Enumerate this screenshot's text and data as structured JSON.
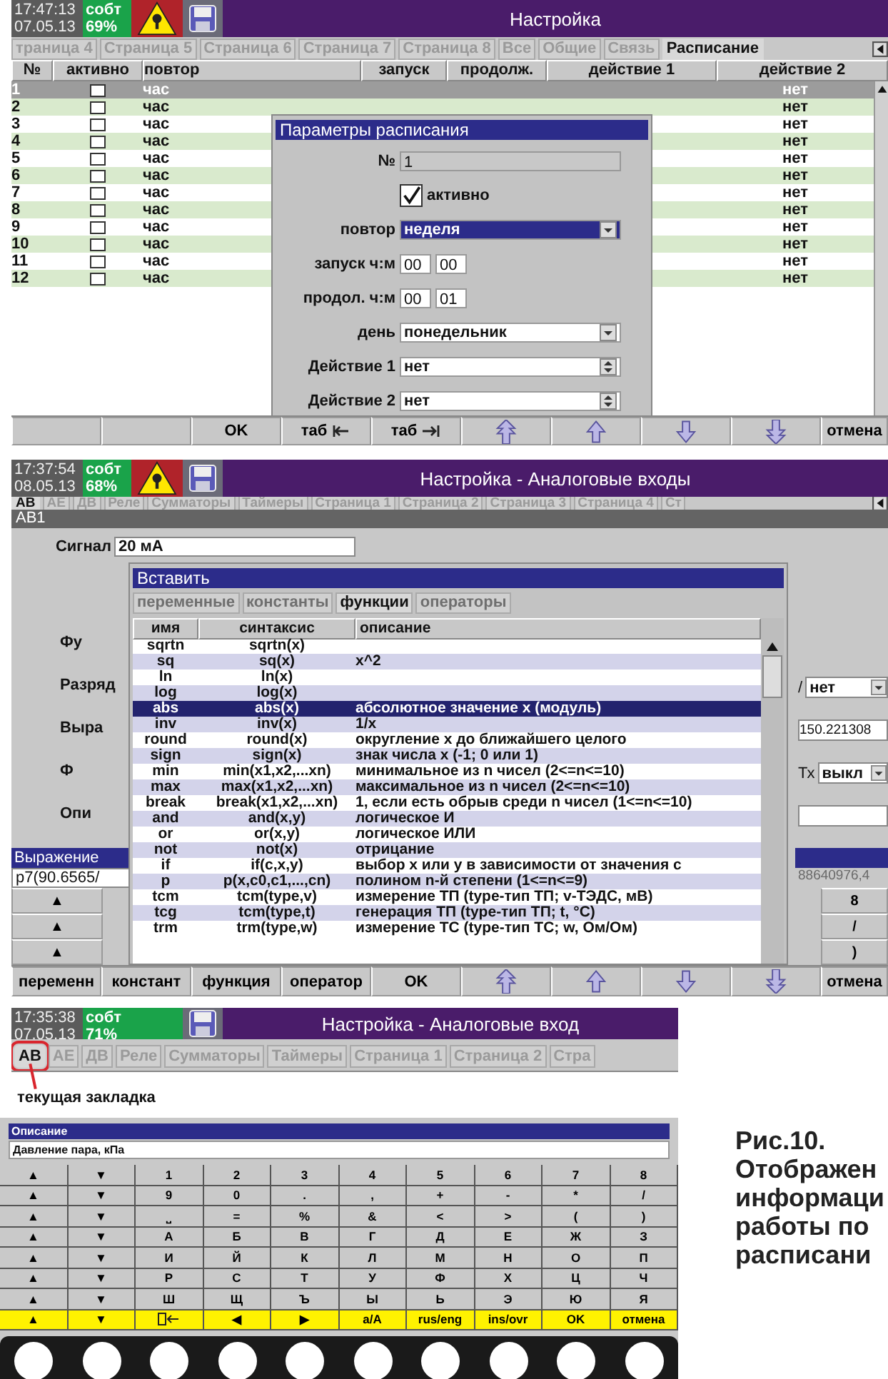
{
  "schedule_screen": {
    "status": {
      "time": "17:47:13",
      "date": "07.05.13",
      "mode": "собт",
      "percent": "69%",
      "warning": true
    },
    "title": "Настройка",
    "tabs": [
      {
        "label": "траница 4",
        "selected": false
      },
      {
        "label": "Страница 5",
        "selected": false
      },
      {
        "label": "Страница 6",
        "selected": false
      },
      {
        "label": "Страница 7",
        "selected": false
      },
      {
        "label": "Страница 8",
        "selected": false
      },
      {
        "label": "Все",
        "selected": false
      },
      {
        "label": "Общие",
        "selected": false
      },
      {
        "label": "Связь",
        "selected": false
      },
      {
        "label": "Расписание",
        "selected": true
      }
    ],
    "columns": [
      "№",
      "активно",
      "повтор",
      "запуск",
      "продолж.",
      "действие 1",
      "действие 2"
    ],
    "rows": [
      {
        "num": "1",
        "active": false,
        "repeat": "час",
        "action_2": "нет",
        "selected": true
      },
      {
        "num": "2",
        "active": false,
        "repeat": "час",
        "action_2": "нет",
        "selected": false
      },
      {
        "num": "3",
        "active": false,
        "repeat": "час",
        "action_2": "нет",
        "selected": false
      },
      {
        "num": "4",
        "active": false,
        "repeat": "час",
        "action_2": "нет",
        "selected": false
      },
      {
        "num": "5",
        "active": false,
        "repeat": "час",
        "action_2": "нет",
        "selected": false
      },
      {
        "num": "6",
        "active": false,
        "repeat": "час",
        "action_2": "нет",
        "selected": false
      },
      {
        "num": "7",
        "active": false,
        "repeat": "час",
        "action_2": "нет",
        "selected": false
      },
      {
        "num": "8",
        "active": false,
        "repeat": "час",
        "action_2": "нет",
        "selected": false
      },
      {
        "num": "9",
        "active": false,
        "repeat": "час",
        "action_2": "нет",
        "selected": false
      },
      {
        "num": "10",
        "active": false,
        "repeat": "час",
        "action_2": "нет",
        "selected": false
      },
      {
        "num": "11",
        "active": false,
        "repeat": "час",
        "action_2": "нет",
        "selected": false
      },
      {
        "num": "12",
        "active": false,
        "repeat": "час",
        "action_2": "нет",
        "selected": false
      }
    ],
    "dialog": {
      "title": "Параметры расписания",
      "number_label": "№",
      "number": "1",
      "active_label": "активно",
      "active": true,
      "fields": [
        {
          "kind": "select",
          "label": "повтор",
          "value": "неделя",
          "highlighted": true
        },
        {
          "kind": "time",
          "label": "запуск ч:м",
          "hours": "00",
          "minutes": "00"
        },
        {
          "kind": "time",
          "label": "продол. ч:м",
          "hours": "00",
          "minutes": "01"
        },
        {
          "kind": "select",
          "label": "день",
          "value": "понедельник",
          "highlighted": false
        },
        {
          "kind": "spin",
          "label": "Действие 1",
          "value": "нет"
        },
        {
          "kind": "spin",
          "label": "Действие 2",
          "value": "нет"
        }
      ]
    },
    "buttons": [
      {
        "kind": "blank"
      },
      {
        "kind": "blank"
      },
      {
        "kind": "text",
        "label": "OK"
      },
      {
        "kind": "tableft",
        "label": "таб"
      },
      {
        "kind": "tabright",
        "label": "таб"
      },
      {
        "kind": "pageup"
      },
      {
        "kind": "up"
      },
      {
        "kind": "down"
      },
      {
        "kind": "pagedown"
      },
      {
        "kind": "text",
        "label": "отмена"
      }
    ]
  },
  "formula_screen": {
    "status": {
      "time": "17:37:54",
      "date": "08.05.13",
      "mode": "собт",
      "percent": "68%",
      "warning": true
    },
    "title": "Настройка - Аналоговые входы",
    "tabs": [
      {
        "label": "АВ",
        "selected": true
      },
      {
        "label": "АЕ",
        "selected": false
      },
      {
        "label": "ДВ",
        "selected": false
      },
      {
        "label": "Реле",
        "selected": false
      },
      {
        "label": "Сумматоры",
        "selected": false
      },
      {
        "label": "Таймеры",
        "selected": false
      },
      {
        "label": "Страница 1",
        "selected": false
      },
      {
        "label": "Страница 2",
        "selected": false
      },
      {
        "label": "Страница 3",
        "selected": false
      },
      {
        "label": "Страница 4",
        "selected": false
      },
      {
        "label": "Ст",
        "selected": false
      }
    ],
    "subtitle": "АВ1",
    "signal_label": "Сигнал",
    "signal_value": "20 мА",
    "form_rows": [
      {
        "label": "Фу",
        "kind": "plain"
      },
      {
        "label": "Разряд",
        "kind": "select",
        "prefix": "/",
        "value": "нет"
      },
      {
        "label": "Выра",
        "kind": "field",
        "value": "150.221308"
      },
      {
        "label": "Ф",
        "kind": "select",
        "prefix": "Тх",
        "value": "выкл"
      },
      {
        "label": "Опи",
        "kind": "field"
      }
    ],
    "expression": {
      "label": "Выражение",
      "value": "p7(90.6565/",
      "tail": "88640976,4"
    },
    "left_keys": [
      "▲",
      "▲",
      "▲"
    ],
    "right_keys": [
      "8",
      "/",
      ")"
    ],
    "dialog": {
      "title": "Вставить",
      "tabs": [
        {
          "label": "переменные",
          "selected": false
        },
        {
          "label": "константы",
          "selected": false
        },
        {
          "label": "функции",
          "selected": true
        },
        {
          "label": "операторы",
          "selected": false
        }
      ],
      "columns": [
        "имя",
        "синтаксис",
        "описание"
      ],
      "rows": [
        {
          "name": "sqrtn",
          "syntax": "sqrtn(x)",
          "selected": false
        },
        {
          "name": "sq",
          "syntax": "sq(x)",
          "description": "x^2",
          "selected": false
        },
        {
          "name": "ln",
          "syntax": "ln(x)",
          "selected": false
        },
        {
          "name": "log",
          "syntax": "log(x)",
          "selected": false
        },
        {
          "name": "abs",
          "syntax": "abs(x)",
          "description": "абсолютное значение х (модуль)",
          "selected": true
        },
        {
          "name": "inv",
          "syntax": "inv(x)",
          "description": "1/x",
          "selected": false
        },
        {
          "name": "round",
          "syntax": "round(x)",
          "description": "округление х до ближайшего целого",
          "selected": false
        },
        {
          "name": "sign",
          "syntax": "sign(x)",
          "description": "знак числа х (-1; 0 или 1)",
          "selected": false
        },
        {
          "name": "min",
          "syntax": "min(x1,x2,...xn)",
          "description": "минимальное из n чисел (2<=n<=10)",
          "selected": false
        },
        {
          "name": "max",
          "syntax": "max(x1,x2,...xn)",
          "description": "максимальное из n чисел (2<=n<=10)",
          "selected": false
        },
        {
          "name": "break",
          "syntax": "break(x1,x2,...xn)",
          "description": "1, если есть обрыв среди n чисел (1<=n<=10)",
          "selected": false
        },
        {
          "name": "and",
          "syntax": "and(x,y)",
          "description": "логическое И",
          "selected": false
        },
        {
          "name": "or",
          "syntax": "or(x,y)",
          "description": "логическое ИЛИ",
          "selected": false
        },
        {
          "name": "not",
          "syntax": "not(x)",
          "description": "отрицание",
          "selected": false
        },
        {
          "name": "if",
          "syntax": "if(c,x,y)",
          "description": "выбор х или у в зависимости от значения с",
          "selected": false
        },
        {
          "name": "p",
          "syntax": "p(x,c0,c1,...,cn)",
          "description": "полином n-й степени (1<=n<=9)",
          "selected": false
        },
        {
          "name": "tcm",
          "syntax": "tcm(type,v)",
          "description": "измерение ТП (type-тип ТП; v-ТЭДС, мВ)",
          "selected": false
        },
        {
          "name": "tcg",
          "syntax": "tcm(type,t)",
          "description": "генерация ТП (type-тип ТП; t, °С)",
          "selected": false
        },
        {
          "name": "trm",
          "syntax": "trm(type,w)",
          "description": "измерение ТС (type-тип ТС; w, Ом/Ом)",
          "selected": false
        }
      ]
    },
    "buttons": [
      {
        "kind": "text",
        "label": "переменн"
      },
      {
        "kind": "text",
        "label": "констант"
      },
      {
        "kind": "text",
        "label": "функция"
      },
      {
        "kind": "text",
        "label": "оператор"
      },
      {
        "kind": "text",
        "label": "OK"
      },
      {
        "kind": "pageup"
      },
      {
        "kind": "up"
      },
      {
        "kind": "down"
      },
      {
        "kind": "pagedown"
      },
      {
        "kind": "text",
        "label": "отмена"
      }
    ]
  },
  "tabs_screen": {
    "status": {
      "time": "17:35:38",
      "date": "07.05.13",
      "mode": "собт",
      "percent": "71%",
      "warning": false
    },
    "title": "Настройка - Аналоговые вход",
    "tabs": [
      {
        "label": "АВ",
        "selected": true
      },
      {
        "label": "АЕ",
        "selected": false
      },
      {
        "label": "ДВ",
        "selected": false
      },
      {
        "label": "Реле",
        "selected": false
      },
      {
        "label": "Сумматоры",
        "selected": false
      },
      {
        "label": "Таймеры",
        "selected": false
      },
      {
        "label": "Страница 1",
        "selected": false
      },
      {
        "label": "Страница 2",
        "selected": false
      },
      {
        "label": "Стра",
        "selected": false
      }
    ],
    "annotation": "текущая закладка"
  },
  "keyboard": {
    "title": "Описание",
    "value": "Давление пара, кПа",
    "rows": [
      {
        "kind": "keys",
        "keys": [
          "▲",
          "▼",
          "1",
          "2",
          "3",
          "4",
          "5",
          "6",
          "7",
          "8"
        ]
      },
      {
        "kind": "keys",
        "keys": [
          "▲",
          "▼",
          "9",
          "0",
          ".",
          ",",
          "+",
          "-",
          "*",
          "/"
        ]
      },
      {
        "kind": "keys",
        "keys": [
          "▲",
          "▼",
          "⎵",
          "=",
          "%",
          "&",
          "<",
          ">",
          "(",
          ")"
        ]
      },
      {
        "kind": "keys",
        "keys": [
          "▲",
          "▼",
          "А",
          "Б",
          "В",
          "Г",
          "Д",
          "Е",
          "Ж",
          "З"
        ]
      },
      {
        "kind": "keys",
        "keys": [
          "▲",
          "▼",
          "И",
          "Й",
          "К",
          "Л",
          "М",
          "Н",
          "О",
          "П"
        ]
      },
      {
        "kind": "keys",
        "keys": [
          "▲",
          "▼",
          "Р",
          "С",
          "Т",
          "У",
          "Ф",
          "Х",
          "Ц",
          "Ч"
        ]
      },
      {
        "kind": "keys",
        "keys": [
          "▲",
          "▼",
          "Ш",
          "Щ",
          "Ъ",
          "Ы",
          "Ь",
          "Э",
          "Ю",
          "Я"
        ]
      },
      {
        "kind": "function",
        "keys": [
          "▲",
          "▼",
          {
            "kind": "erase"
          },
          "◀",
          "▶",
          "a/A",
          "rus/eng",
          "ins/ovr",
          "OK",
          "отмена"
        ]
      }
    ]
  },
  "caption": {
    "figure": "Рис.10.",
    "lines": [
      "Отображен",
      "информаци",
      "работы по",
      "расписани"
    ]
  }
}
